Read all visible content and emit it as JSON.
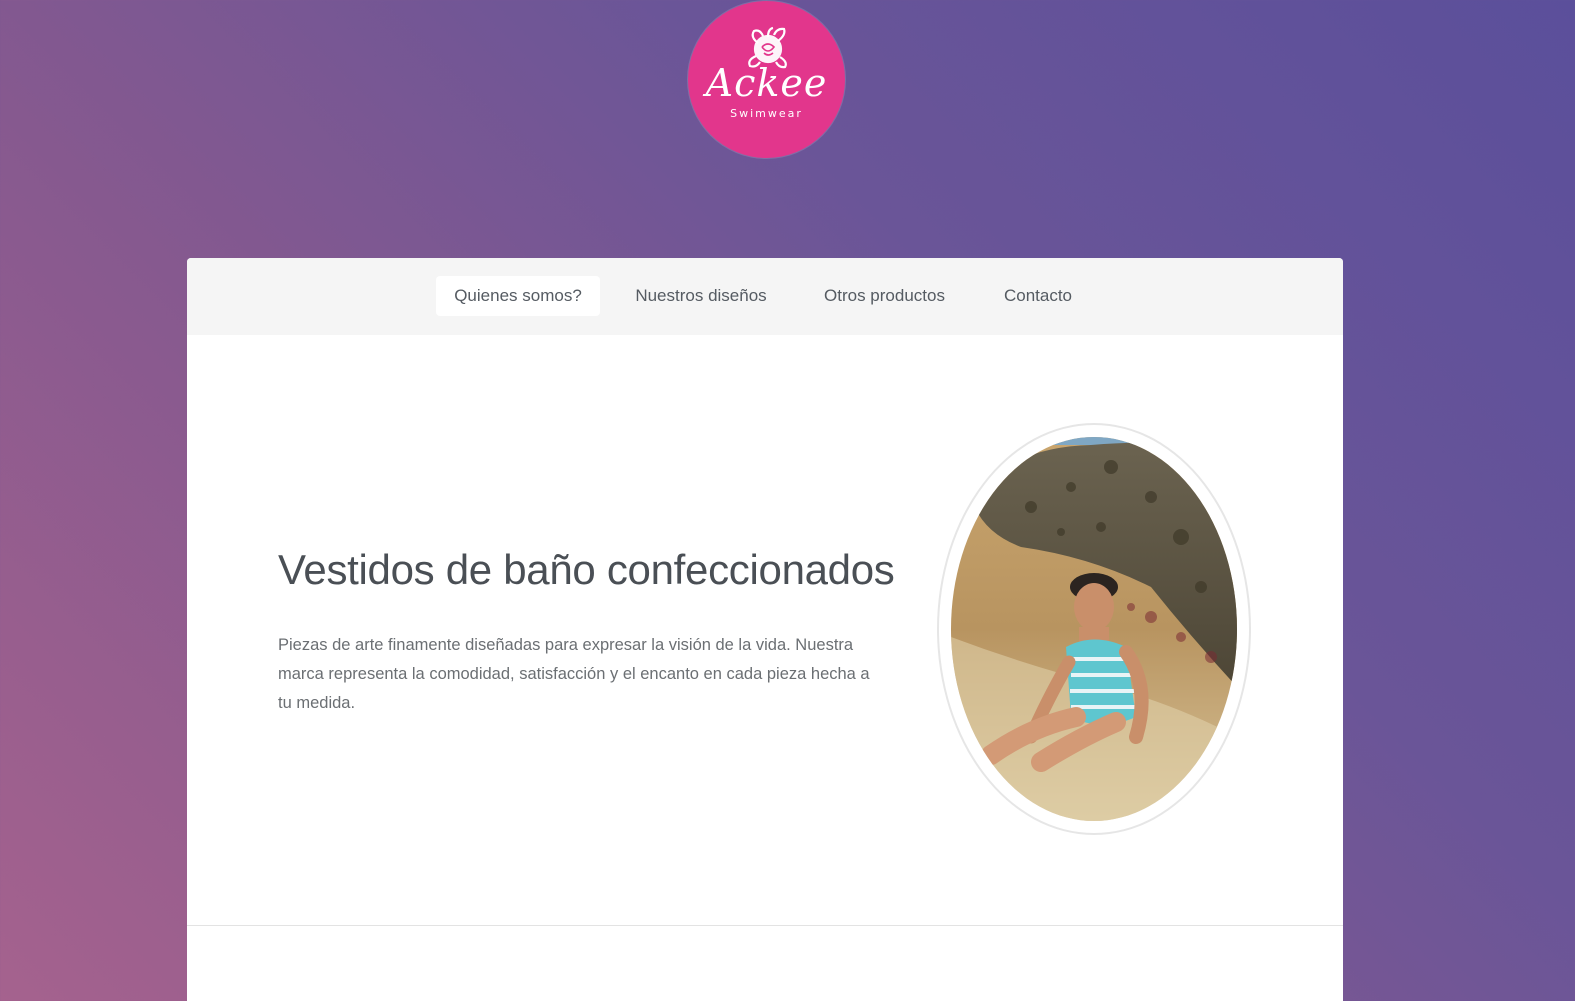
{
  "brand": {
    "logo_script": "Ackee",
    "logo_sub": "Swimwear",
    "accent_color": "#e2368c"
  },
  "nav": {
    "items": [
      {
        "label": "Quienes somos?",
        "active": true
      },
      {
        "label": "Nuestros diseños",
        "active": false
      },
      {
        "label": "Otros productos",
        "active": false
      },
      {
        "label": "Contacto",
        "active": false
      }
    ]
  },
  "hero": {
    "title": "Vestidos de baño confeccionados",
    "description": "Piezas de arte finamente diseñadas para expresar la visión de la vida. Nuestra marca representa la comodidad, satisfacción y el encanto en cada pieza hecha a tu medida.",
    "photo_icon": "beach-photo"
  }
}
